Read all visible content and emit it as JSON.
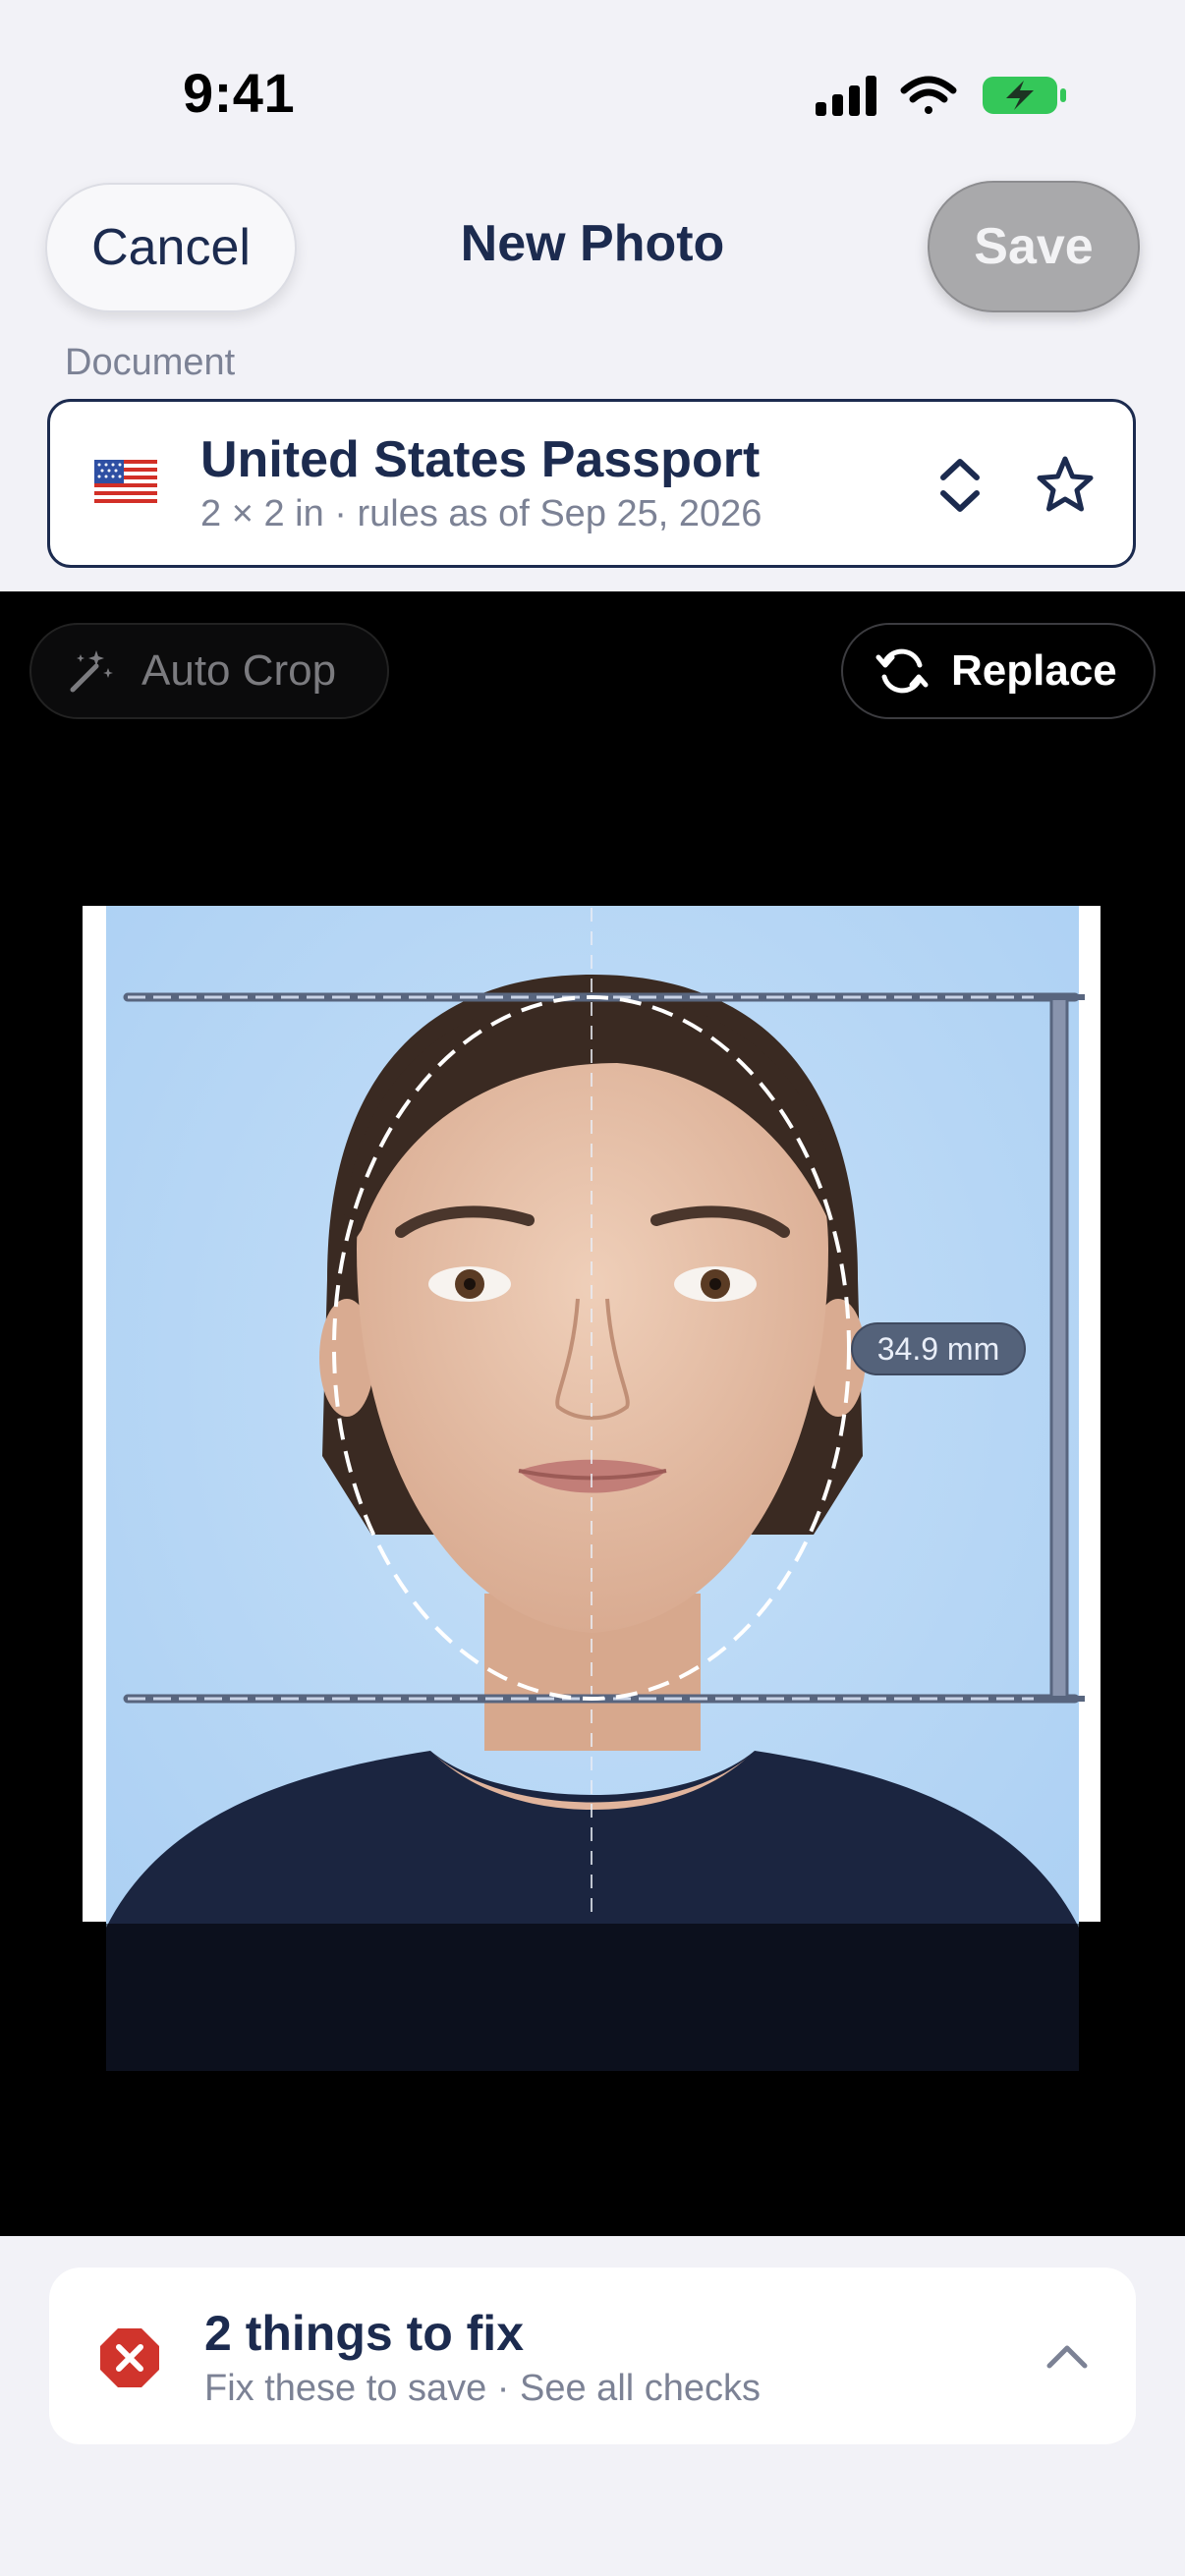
{
  "status_bar": {
    "time": "9:41"
  },
  "nav": {
    "cancel_label": "Cancel",
    "title": "New Photo",
    "save_label": "Save"
  },
  "document": {
    "section_label": "Document",
    "flag": "us-flag",
    "name": "United States Passport",
    "details": "2 × 2 in · rules as of Sep 25, 2026"
  },
  "editor": {
    "auto_crop_label": "Auto Crop",
    "replace_label": "Replace",
    "head_measure": "34.9 mm"
  },
  "checks": {
    "title": "2 things to fix",
    "subtitle": "Fix these to save · See all checks",
    "status_color": "#d0342c"
  },
  "colors": {
    "accent": "#1c2b4f",
    "battery": "#34c759",
    "photo_background": "#b9d7f5"
  }
}
